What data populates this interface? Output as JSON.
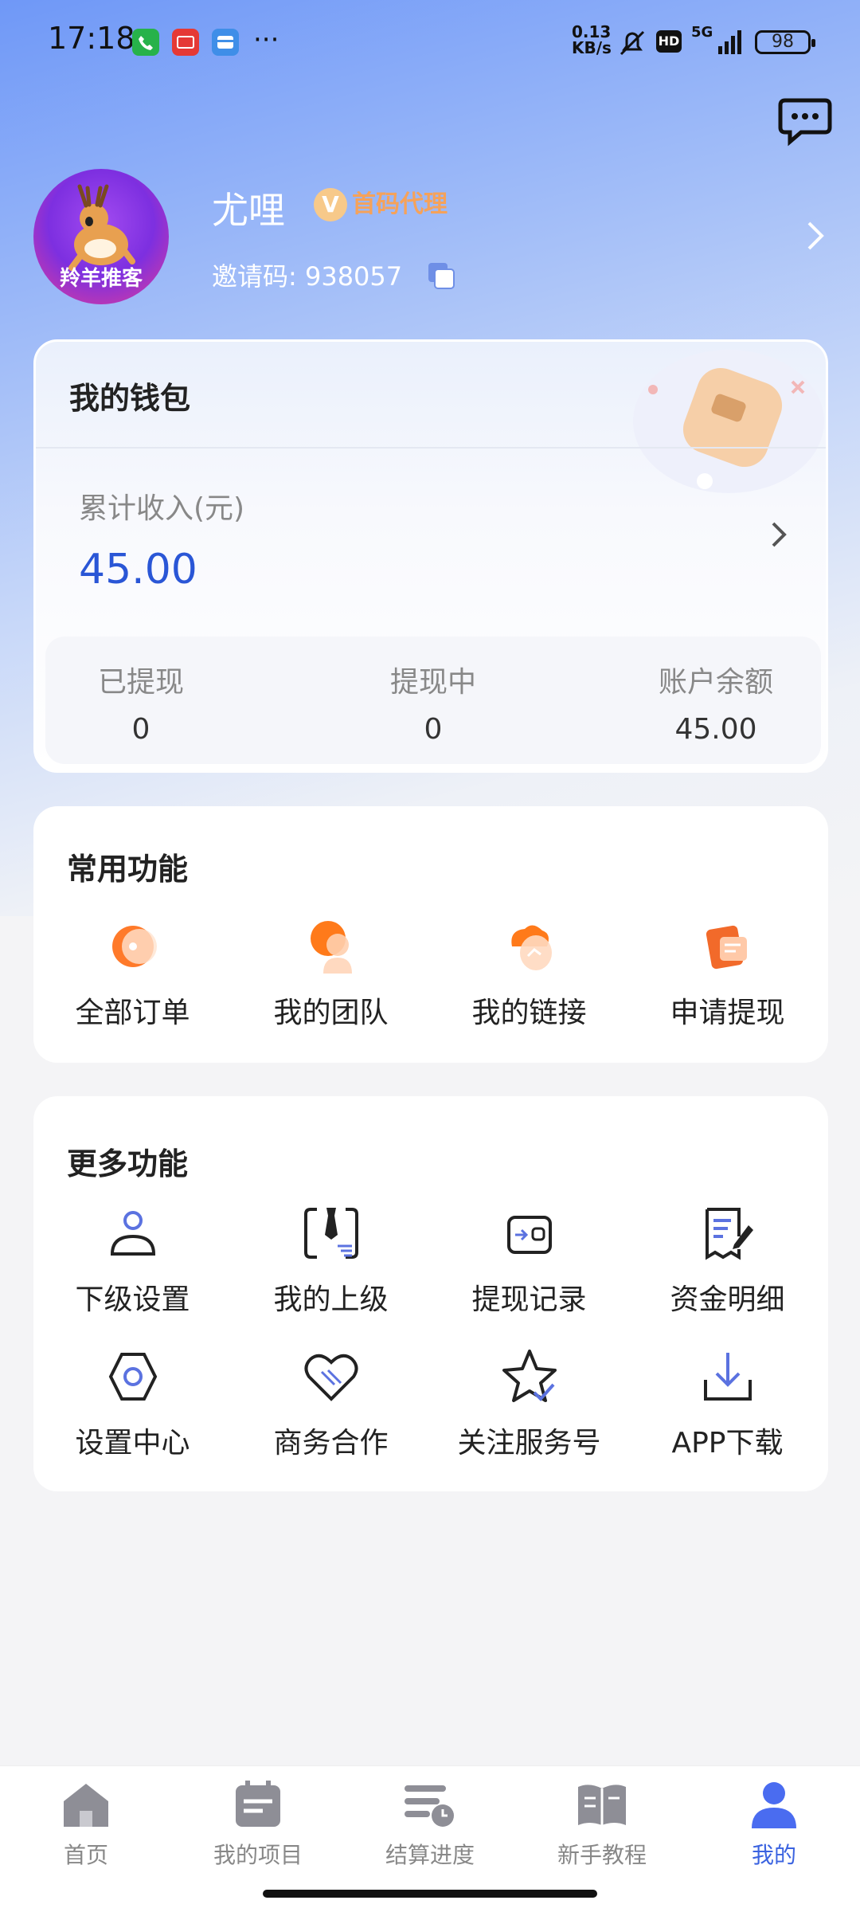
{
  "status_bar": {
    "time": "17:18",
    "network_speed_top": "0.13",
    "network_speed_bottom": "KB/s",
    "hd": "HD",
    "signal": "5G",
    "battery": "98"
  },
  "profile": {
    "avatar_text": "羚羊推客",
    "name": "尤哩",
    "badge": "首码代理",
    "badge_letter": "V",
    "invite_label": "邀请码:",
    "invite_code": "938057"
  },
  "wallet": {
    "title": "我的钱包",
    "income_label": "累计收入(元)",
    "income_value": "45.00",
    "stats": [
      {
        "label": "已提现",
        "value": "0"
      },
      {
        "label": "提现中",
        "value": "0"
      },
      {
        "label": "账户余额",
        "value": "45.00"
      }
    ]
  },
  "common": {
    "title": "常用功能",
    "items": [
      {
        "label": "全部订单",
        "icon": "orders-icon"
      },
      {
        "label": "我的团队",
        "icon": "team-icon"
      },
      {
        "label": "我的链接",
        "icon": "link-icon"
      },
      {
        "label": "申请提现",
        "icon": "withdraw-icon"
      }
    ]
  },
  "more": {
    "title": "更多功能",
    "items": [
      {
        "label": "下级设置",
        "icon": "user-icon"
      },
      {
        "label": "我的上级",
        "icon": "superior-icon"
      },
      {
        "label": "提现记录",
        "icon": "wallet-icon"
      },
      {
        "label": "资金明细",
        "icon": "document-icon"
      },
      {
        "label": "设置中心",
        "icon": "hexagon-settings-icon"
      },
      {
        "label": "商务合作",
        "icon": "handshake-heart-icon"
      },
      {
        "label": "关注服务号",
        "icon": "star-check-icon"
      },
      {
        "label": "APP下载",
        "icon": "download-icon"
      }
    ]
  },
  "nav": {
    "items": [
      {
        "label": "首页",
        "icon": "home-icon"
      },
      {
        "label": "我的项目",
        "icon": "calendar-icon"
      },
      {
        "label": "结算进度",
        "icon": "progress-icon"
      },
      {
        "label": "新手教程",
        "icon": "book-icon"
      },
      {
        "label": "我的",
        "icon": "person-icon"
      }
    ],
    "active_index": 4
  },
  "colors": {
    "accent": "#3b63e0",
    "income": "#2a56d6",
    "orange": "#f56a1e",
    "icon_blue": "#4e6be0"
  }
}
